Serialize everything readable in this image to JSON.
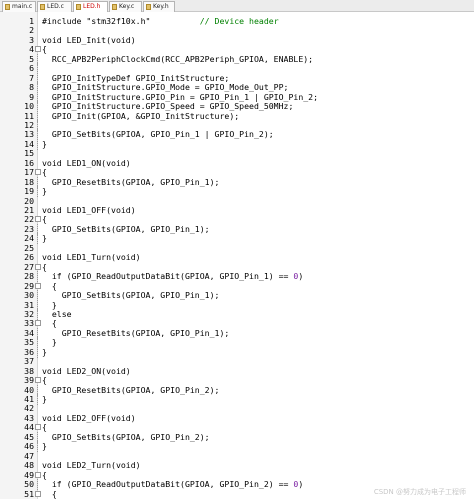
{
  "tabs": [
    {
      "label": "main.c",
      "active": false
    },
    {
      "label": "LED.c",
      "active": false
    },
    {
      "label": "LED.h",
      "active": true
    },
    {
      "label": "Key.c",
      "active": false
    },
    {
      "label": "Key.h",
      "active": false
    }
  ],
  "code_lines": [
    {
      "n": "1",
      "t": "#include \"stm32f10x.h\"",
      "c": "// Device header"
    },
    {
      "n": "2",
      "t": ""
    },
    {
      "n": "3",
      "t": "void LED_Init(void)"
    },
    {
      "n": "4",
      "t": "{"
    },
    {
      "n": "5",
      "t": "  RCC_APB2PeriphClockCmd(RCC_APB2Periph_GPIOA, ENABLE);"
    },
    {
      "n": "6",
      "t": ""
    },
    {
      "n": "7",
      "t": "  GPIO_InitTypeDef GPIO_InitStructure;"
    },
    {
      "n": "8",
      "t": "  GPIO_InitStructure.GPIO_Mode = GPIO_Mode_Out_PP;"
    },
    {
      "n": "9",
      "t": "  GPIO_InitStructure.GPIO_Pin = GPIO_Pin_1 | GPIO_Pin_2;"
    },
    {
      "n": "10",
      "t": "  GPIO_InitStructure.GPIO_Speed = GPIO_Speed_50MHz;"
    },
    {
      "n": "11",
      "t": "  GPIO_Init(GPIOA, &GPIO_InitStructure);"
    },
    {
      "n": "12",
      "t": ""
    },
    {
      "n": "13",
      "t": "  GPIO_SetBits(GPIOA, GPIO_Pin_1 | GPIO_Pin_2);"
    },
    {
      "n": "14",
      "t": "}"
    },
    {
      "n": "15",
      "t": ""
    },
    {
      "n": "16",
      "t": "void LED1_ON(void)"
    },
    {
      "n": "17",
      "t": "{"
    },
    {
      "n": "18",
      "t": "  GPIO_ResetBits(GPIOA, GPIO_Pin_1);"
    },
    {
      "n": "19",
      "t": "}"
    },
    {
      "n": "20",
      "t": ""
    },
    {
      "n": "21",
      "t": "void LED1_OFF(void)"
    },
    {
      "n": "22",
      "t": "{"
    },
    {
      "n": "23",
      "t": "  GPIO_SetBits(GPIOA, GPIO_Pin_1);"
    },
    {
      "n": "24",
      "t": "}"
    },
    {
      "n": "25",
      "t": ""
    },
    {
      "n": "26",
      "t": "void LED1_Turn(void)"
    },
    {
      "n": "27",
      "t": "{"
    },
    {
      "n": "28",
      "t": "  if (GPIO_ReadOutputDataBit(GPIOA, GPIO_Pin_1) == ",
      "num": "0",
      "after": ")"
    },
    {
      "n": "29",
      "t": "  {"
    },
    {
      "n": "30",
      "t": "    GPIO_SetBits(GPIOA, GPIO_Pin_1);"
    },
    {
      "n": "31",
      "t": "  }"
    },
    {
      "n": "32",
      "t": "  else"
    },
    {
      "n": "33",
      "t": "  {"
    },
    {
      "n": "34",
      "t": "    GPIO_ResetBits(GPIOA, GPIO_Pin_1);"
    },
    {
      "n": "35",
      "t": "  }"
    },
    {
      "n": "36",
      "t": "}"
    },
    {
      "n": "37",
      "t": ""
    },
    {
      "n": "38",
      "t": "void LED2_ON(void)"
    },
    {
      "n": "39",
      "t": "{"
    },
    {
      "n": "40",
      "t": "  GPIO_ResetBits(GPIOA, GPIO_Pin_2);"
    },
    {
      "n": "41",
      "t": "}"
    },
    {
      "n": "42",
      "t": ""
    },
    {
      "n": "43",
      "t": "void LED2_OFF(void)"
    },
    {
      "n": "44",
      "t": "{"
    },
    {
      "n": "45",
      "t": "  GPIO_SetBits(GPIOA, GPIO_Pin_2);"
    },
    {
      "n": "46",
      "t": "}"
    },
    {
      "n": "47",
      "t": ""
    },
    {
      "n": "48",
      "t": "void LED2_Turn(void)"
    },
    {
      "n": "49",
      "t": "{"
    },
    {
      "n": "50",
      "t": "  if (GPIO_ReadOutputDataBit(GPIOA, GPIO_Pin_2) == ",
      "num": "0",
      "after": ")"
    },
    {
      "n": "51",
      "t": "  {"
    }
  ],
  "watermark": "CSDN @努力成为电子工程师"
}
